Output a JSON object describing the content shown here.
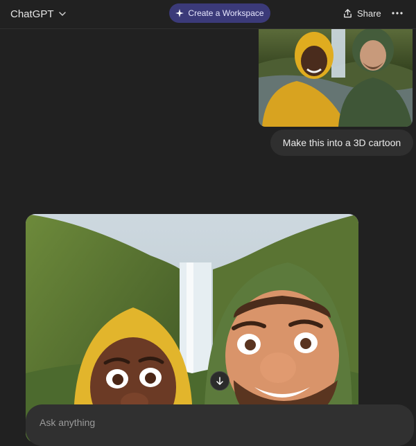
{
  "header": {
    "model_name": "ChatGPT",
    "workspace_label": "Create a Workspace",
    "share_label": "Share",
    "icons": {
      "model_chevron": "chevron-down-icon",
      "workspace": "sparkle-icon",
      "share": "share-icon",
      "more": "more-horizontal-icon"
    }
  },
  "conversation": {
    "user_message": "Make this into a 3D cartoon",
    "user_attachment": "photo",
    "assistant_response": "generated-image"
  },
  "scroll_button": {
    "icon": "arrow-down-icon"
  },
  "composer": {
    "placeholder": "Ask anything"
  },
  "colors": {
    "background": "#212121",
    "workspace_button": "#3b3a79",
    "bubble": "#2f2f2f",
    "composer": "#303030"
  }
}
